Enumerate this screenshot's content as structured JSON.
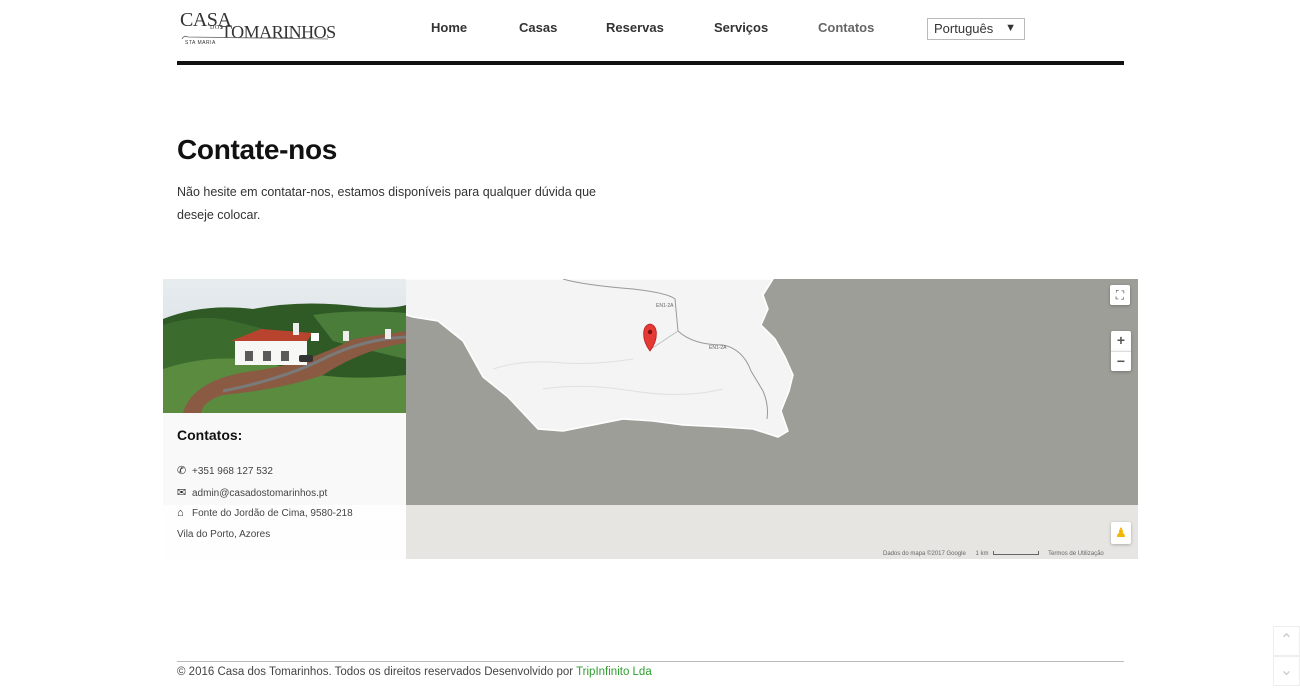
{
  "brand": {
    "logo_top": "CASA",
    "logo_small": "DOS",
    "logo_main": "TOMARINHOS",
    "logo_sub": "STA MARIA"
  },
  "nav": {
    "items": [
      {
        "label": "Home"
      },
      {
        "label": "Casas"
      },
      {
        "label": "Reservas"
      },
      {
        "label": "Serviços"
      },
      {
        "label": "Contatos",
        "active": true
      }
    ],
    "language": "Português"
  },
  "page": {
    "title": "Contate-nos",
    "intro": "Não hesite em contatar-nos, estamos disponíveis para qualquer dúvida que deseje colocar."
  },
  "contact": {
    "heading": "Contatos:",
    "phone": "+351 968 127 532",
    "email": "admin@casadostomarinhos.pt",
    "address_line1": "Fonte do Jordão de Cima, 9580-218",
    "address_line2": "Vila do Porto, Azores"
  },
  "map": {
    "road_label_1": "EN1-2A",
    "road_label_2": "EN1-2A",
    "attribution": "Dados do mapa ©2017 Google",
    "scale": "1 km",
    "terms": "Termos de Utilização",
    "zoom_in": "+",
    "zoom_out": "−",
    "fullscreen": "⛶"
  },
  "footer": {
    "text": "© 2016 Casa dos Tomarinhos. Todos os direitos reservados Desenvolvido por",
    "link": "TripInfinito Lda"
  },
  "colors": {
    "sea": "#9d9e98",
    "land": "#f4f4f4",
    "marker": "#e53935",
    "footer_link": "#2f9e2f"
  }
}
